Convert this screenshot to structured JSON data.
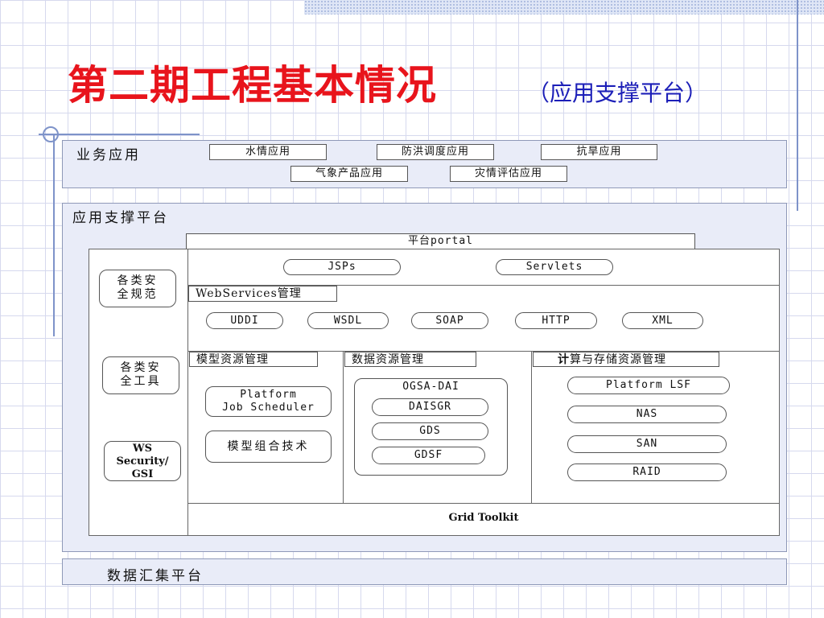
{
  "title": {
    "main": "第二期工程基本情况",
    "sub": "（应用支撑平台）"
  },
  "business_apps": {
    "label": "业务应用",
    "items": [
      "水情应用",
      "防洪调度应用",
      "抗旱应用",
      "气象产品应用",
      "灾情评估应用"
    ]
  },
  "support_platform": {
    "label": "应用支撑平台",
    "portal": "平台portal",
    "jsps": "JSPs",
    "servlets": "Servlets",
    "webservices_label": "WebServices管理",
    "ws_protocols": [
      "UDDI",
      "WSDL",
      "SOAP",
      "HTTP",
      "XML"
    ],
    "security": {
      "spec": [
        "各类安",
        "全规范"
      ],
      "tools": [
        "各类安",
        "全工具"
      ],
      "ws_security": [
        "WS",
        "Security/",
        "GSI"
      ]
    },
    "model_mgmt": {
      "label": "模型资源管理",
      "scheduler": [
        "Platform",
        "Job Scheduler"
      ],
      "combination": "模型组合技术"
    },
    "data_mgmt": {
      "label": "数据资源管理",
      "ogsa": "OGSA-DAI",
      "items": [
        "DAISGR",
        "GDS",
        "GDSF"
      ]
    },
    "compute_mgmt": {
      "label_bold": "计",
      "label_rest": "算与存储资源管理",
      "items": [
        "Platform LSF",
        "NAS",
        "SAN",
        "RAID"
      ]
    },
    "grid_toolkit": "Grid Toolkit"
  },
  "data_platform": {
    "label": "数据汇集平台"
  },
  "colors": {
    "title_red": "#e8141c",
    "subtitle_blue": "#1c1fb8",
    "panel_bg": "#e9ecf8",
    "grid_line": "#d6d9ee"
  }
}
